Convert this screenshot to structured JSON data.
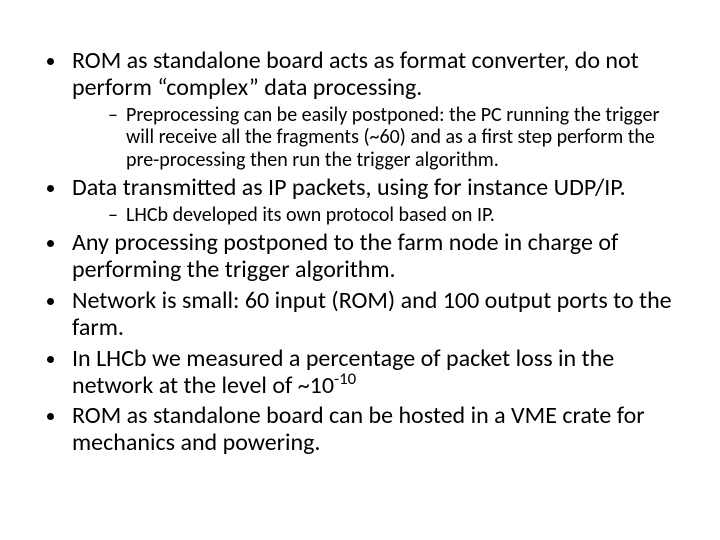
{
  "bullets": [
    {
      "text": "ROM as standalone board acts as format converter, do not perform “complex” data processing.",
      "sub": [
        "Preprocessing can be easily postponed: the PC running the trigger will receive all the fragments (~60) and as a first step perform the pre-processing then run the trigger algorithm."
      ]
    },
    {
      "text": "Data transmitted as IP packets, using for instance UDP/IP.",
      "sub": [
        "LHCb developed its own protocol based on IP."
      ]
    },
    {
      "text": "Any processing postponed to the farm node in charge of performing the trigger algorithm.",
      "sub": []
    },
    {
      "text": "Network is small: 60 input (ROM) and 100 output ports to the farm.",
      "sub": []
    },
    {
      "text_prefix": "In LHCb we measured a percentage of packet loss in the network at the level of  ~10",
      "exp": "-10",
      "sub": []
    },
    {
      "text": "ROM as standalone board can be hosted in a VME crate for mechanics and powering.",
      "sub": []
    }
  ]
}
